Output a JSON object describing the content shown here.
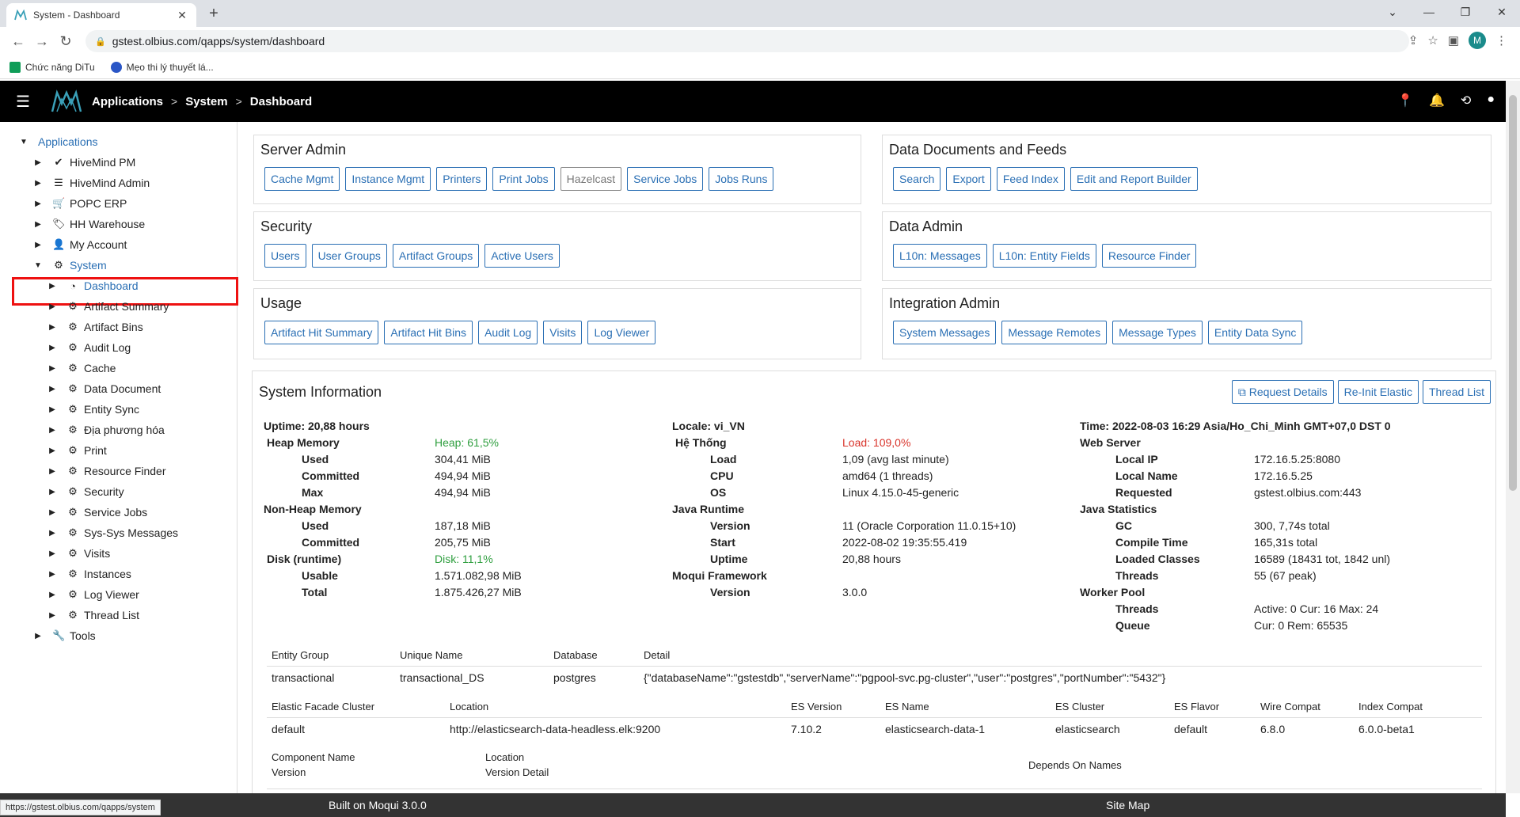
{
  "browser": {
    "tab_title": "System - Dashboard",
    "tab_close": "✕",
    "new_tab": "+",
    "url": "gstest.olbius.com/qapps/system/dashboard",
    "profile_initial": "M",
    "bookmarks": [
      {
        "label": "Chức năng DiTu"
      },
      {
        "label": "Mẹo thi lý thuyết lá..."
      }
    ],
    "status_url": "https://gstest.olbius.com/qapps/system"
  },
  "header": {
    "breadcrumbs": [
      "Applications",
      "System",
      "Dashboard"
    ],
    "separator": ">"
  },
  "sidebar": {
    "root": "Applications",
    "apps": [
      "HiveMind PM",
      "HiveMind Admin",
      "POPC ERP",
      "HH Warehouse",
      "My Account"
    ],
    "system": "System",
    "system_children": [
      "Dashboard",
      "Artifact Summary",
      "Artifact Bins",
      "Audit Log",
      "Cache",
      "Data Document",
      "Entity Sync",
      "Địa phương hóa",
      "Print",
      "Resource Finder",
      "Security",
      "Service Jobs",
      "Sys-Sys Messages",
      "Visits",
      "Instances",
      "Log Viewer",
      "Thread List"
    ],
    "tools": "Tools"
  },
  "panels": {
    "server_admin": {
      "title": "Server Admin",
      "buttons": [
        "Cache Mgmt",
        "Instance Mgmt",
        "Printers",
        "Print Jobs",
        "Hazelcast",
        "Service Jobs",
        "Jobs Runs"
      ]
    },
    "security": {
      "title": "Security",
      "buttons": [
        "Users",
        "User Groups",
        "Artifact Groups",
        "Active Users"
      ]
    },
    "usage": {
      "title": "Usage",
      "buttons": [
        "Artifact Hit Summary",
        "Artifact Hit Bins",
        "Audit Log",
        "Visits",
        "Log Viewer"
      ]
    },
    "data_docs": {
      "title": "Data Documents and Feeds",
      "buttons": [
        "Search",
        "Export",
        "Feed Index",
        "Edit and Report Builder"
      ]
    },
    "data_admin": {
      "title": "Data Admin",
      "buttons": [
        "L10n: Messages",
        "L10n: Entity Fields",
        "Resource Finder"
      ]
    },
    "integration": {
      "title": "Integration Admin",
      "buttons": [
        "System Messages",
        "Message Remotes",
        "Message Types",
        "Entity Data Sync"
      ]
    }
  },
  "sysinfo": {
    "title": "System Information",
    "buttons": [
      "Request Details",
      "Re-Init Elastic",
      "Thread List"
    ],
    "col1": {
      "uptime": "Uptime: 20,88 hours",
      "heap_label": "Heap Memory",
      "heap_pct": "Heap: 61,5%",
      "used_label": "Used",
      "used": "304,41 MiB",
      "committed_label": "Committed",
      "committed": "494,94 MiB",
      "max_label": "Max",
      "max": "494,94 MiB",
      "nonheap_label": "Non-Heap Memory",
      "nh_used_label": "Used",
      "nh_used": "187,18 MiB",
      "nh_committed_label": "Committed",
      "nh_committed": "205,75 MiB",
      "disk_label": "Disk (runtime)",
      "disk_pct": "Disk: 11,1%",
      "usable_label": "Usable",
      "usable": "1.571.082,98 MiB",
      "total_label": "Total",
      "total": "1.875.426,27 MiB"
    },
    "col2": {
      "locale": "Locale: vi_VN",
      "system_label": "Hệ Thống",
      "load_pct": "Load: 109,0%",
      "load_label": "Load",
      "load": "1,09 (avg last minute)",
      "cpu_label": "CPU",
      "cpu": "amd64 (1 threads)",
      "os_label": "OS",
      "os": "Linux 4.15.0-45-generic",
      "java_label": "Java Runtime",
      "version_label": "Version",
      "version": "11 (Oracle Corporation 11.0.15+10)",
      "start_label": "Start",
      "start": "2022-08-02 19:35:55.419",
      "uptime_label": "Uptime",
      "uptime": "20,88 hours",
      "moqui_label": "Moqui Framework",
      "moqui_version_label": "Version",
      "moqui_version": "3.0.0"
    },
    "col3": {
      "time": "Time: 2022-08-03 16:29 Asia/Ho_Chi_Minh GMT+07,0 DST 0",
      "web_label": "Web Server",
      "local_ip_label": "Local IP",
      "local_ip": "172.16.5.25:8080",
      "local_name_label": "Local Name",
      "local_name": "172.16.5.25",
      "requested_label": "Requested",
      "requested": "gstest.olbius.com:443",
      "java_stats_label": "Java Statistics",
      "gc_label": "GC",
      "gc": "300, 7,74s total",
      "compile_label": "Compile Time",
      "compile": "165,31s total",
      "classes_label": "Loaded Classes",
      "classes": "16589 (18431 tot, 1842 unl)",
      "threads_label": "Threads",
      "threads": "55 (67 peak)",
      "worker_label": "Worker Pool",
      "wp_threads_label": "Threads",
      "wp_threads": "Active: 0 Cur: 16 Max: 24",
      "queue_label": "Queue",
      "queue": "Cur: 0 Rem: 65535"
    },
    "entity_table": {
      "headers": [
        "Entity Group",
        "Unique Name",
        "Database",
        "Detail"
      ],
      "row": [
        "transactional",
        "transactional_DS",
        "postgres",
        "{\"databaseName\":\"gstestdb\",\"serverName\":\"pgpool-svc.pg-cluster\",\"user\":\"postgres\",\"portNumber\":\"5432\"}"
      ]
    },
    "es_table": {
      "headers": [
        "Elastic Facade Cluster",
        "Location",
        "ES Version",
        "ES Name",
        "ES Cluster",
        "ES Flavor",
        "Wire Compat",
        "Index Compat"
      ],
      "row": [
        "default",
        "http://elasticsearch-data-headless.elk:9200",
        "7.10.2",
        "elasticsearch-data-1",
        "elasticsearch",
        "default",
        "6.8.0",
        "6.0.0-beta1"
      ]
    },
    "component_table": {
      "h1a": "Component Name",
      "h1b": "Version",
      "h2a": "Location",
      "h2b": "Version Detail",
      "h3": "Depends On Names"
    }
  },
  "footer": {
    "built": "Built on Moqui 3.0.0",
    "sitemap": "Site Map"
  }
}
